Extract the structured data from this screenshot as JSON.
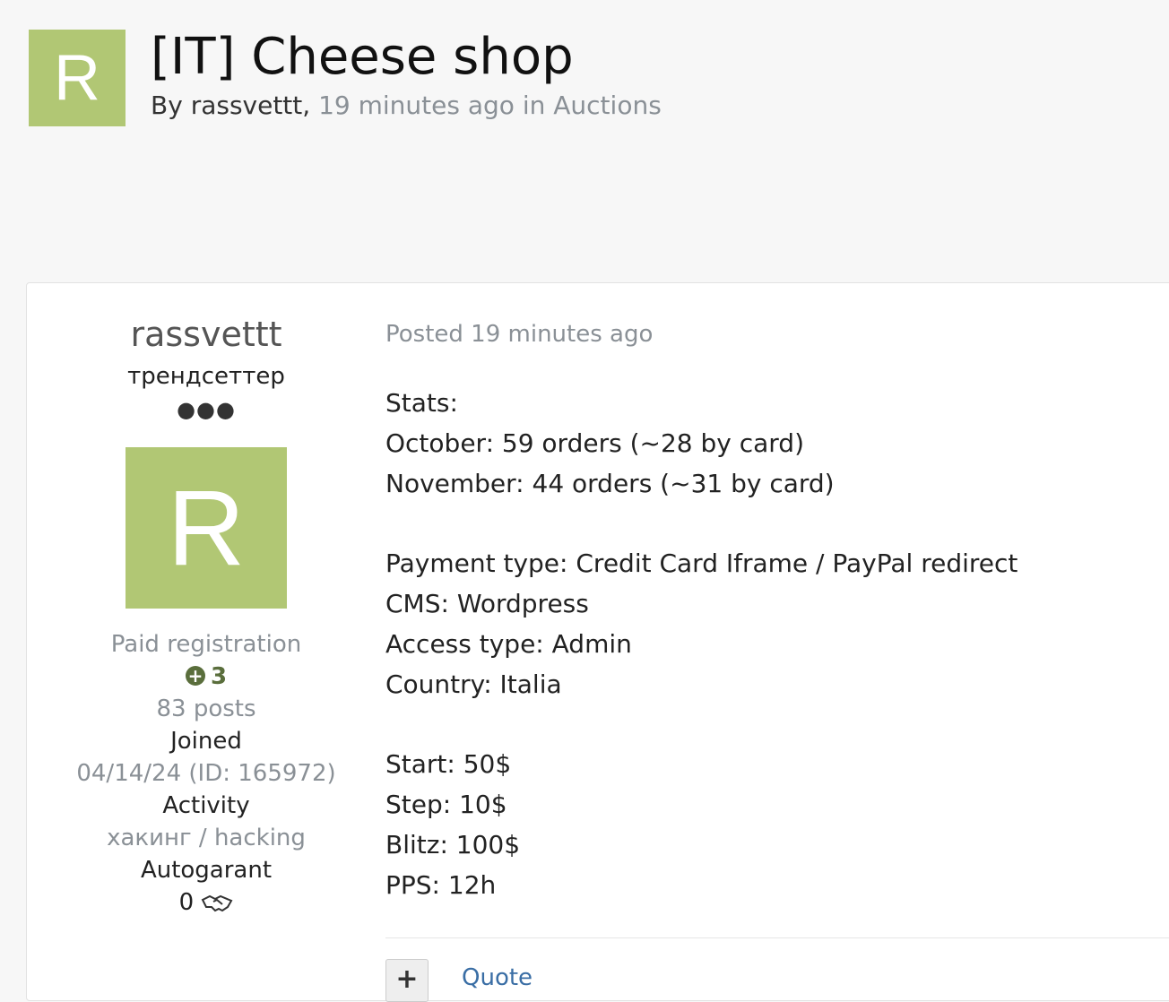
{
  "header": {
    "avatar_letter": "R",
    "title": "[IT] Cheese shop",
    "byline_prefix": "By",
    "author": "rassvettt",
    "comma": ",",
    "time_ago": "19 minutes ago",
    "in_word": "in",
    "category": "Auctions"
  },
  "author_panel": {
    "name": "rassvettt",
    "rank": "трендсеттер",
    "rank_dots": "●●●",
    "avatar_letter": "R",
    "group": "Paid registration",
    "reputation": "3",
    "posts": "83 posts",
    "joined_label": "Joined",
    "joined_value": "04/14/24 (ID: 165972)",
    "activity_label": "Activity",
    "activity_value": "хакинг / hacking",
    "autogarant_label": "Autogarant",
    "autogarant_value": "0"
  },
  "post": {
    "posted": "Posted 19 minutes ago",
    "lines": [
      "Stats:",
      "October: 59 orders (~28 by card)",
      "November: 44 orders (~31 by card)",
      "",
      "Payment type: Credit Card Iframe / PayPal redirect",
      "CMS: Wordpress",
      "Access type: Admin",
      "Country: Italia",
      "",
      "Start: 50$",
      "Step: 10$",
      "Blitz: 100$",
      "PPS: 12h"
    ],
    "plus_label": "+",
    "quote_label": "Quote"
  },
  "colors": {
    "avatar_bg": "#b1c774",
    "muted_text": "#8a9096",
    "reputation": "#5a6e3c",
    "link": "#3a6ea5"
  }
}
